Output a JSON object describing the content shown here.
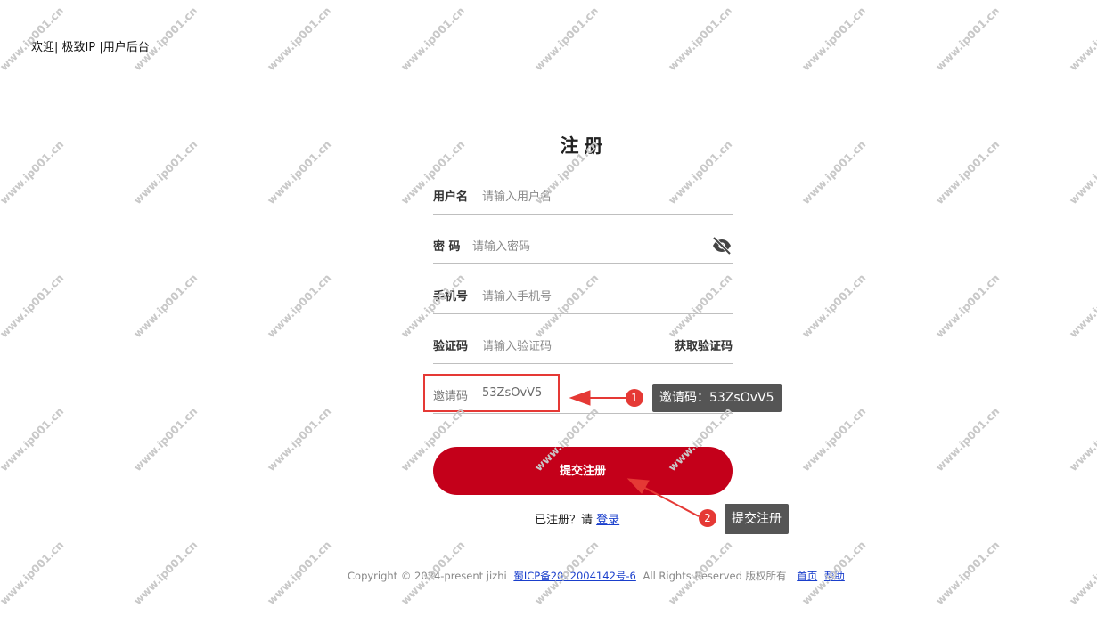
{
  "header": {
    "welcome_text": "欢迎| 极致IP |用户后台"
  },
  "form": {
    "title": "注册",
    "username": {
      "label": "用户名",
      "placeholder": "请输入用户名"
    },
    "password": {
      "label": "密 码",
      "placeholder": "请输入密码",
      "toggle_icon": "eye-slash-icon"
    },
    "phone": {
      "label": "手机号",
      "placeholder": "请输入手机号"
    },
    "code": {
      "label": "验证码",
      "placeholder": "请输入验证码",
      "get_code_label": "获取验证码"
    },
    "invite": {
      "label": "邀请码",
      "value": "53ZsOvV5"
    },
    "submit_label": "提交注册",
    "registered_text": "已注册？请",
    "login_link": "登录"
  },
  "annotations": {
    "callout1_number": "1",
    "callout1_text": "邀请码：53ZsOvV5",
    "callout2_number": "2",
    "callout2_text": "提交注册",
    "accent_color": "#e53935"
  },
  "footer": {
    "copyright_text": "Copyright © 2024-present jizhi",
    "icp_link": "蜀ICP备2022004142号-6",
    "rights_text": "All Rights Reserved 版权所有",
    "home_link": "首页",
    "help_link": "帮助"
  },
  "watermark_text": "www.ip001.cn",
  "colors": {
    "primary": "#c4001a",
    "link": "#1a3fcc"
  }
}
